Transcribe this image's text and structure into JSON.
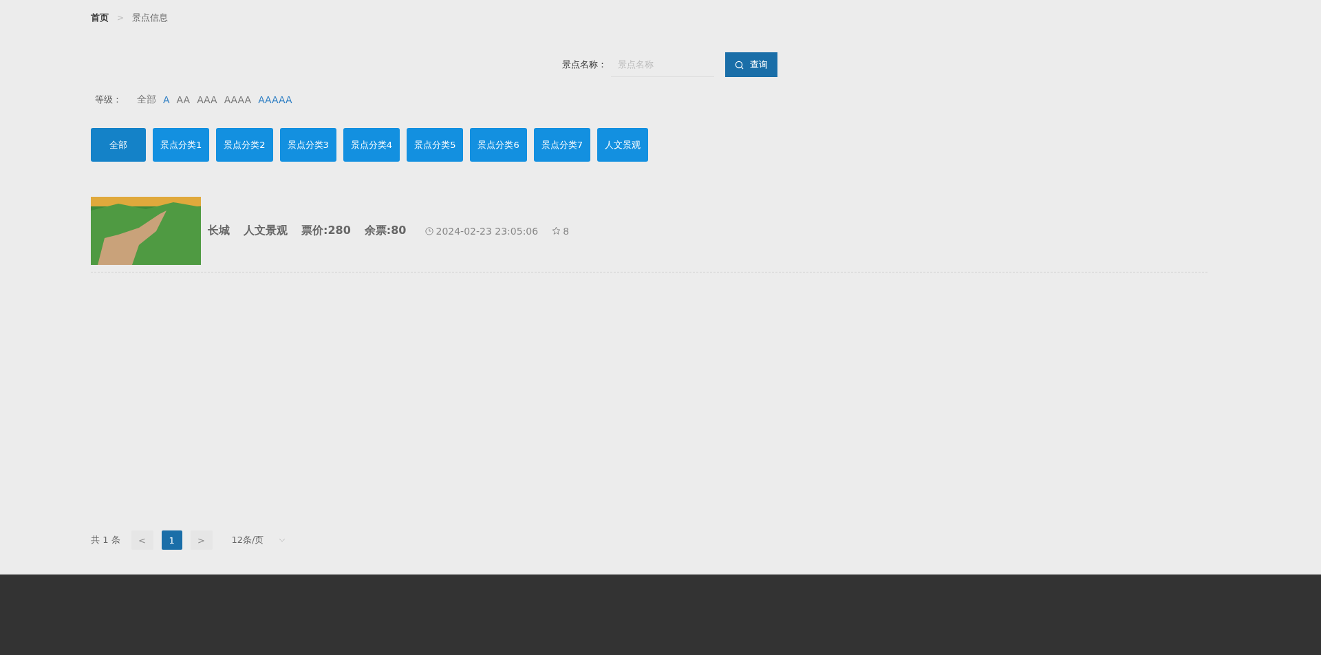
{
  "breadcrumb": [
    {
      "label": "首页",
      "current": false
    },
    {
      "label": "景点信息",
      "current": true
    }
  ],
  "breadcrumb_separator": ">",
  "search": {
    "label": "景点名称：",
    "placeholder": "景点名称",
    "button": "查询"
  },
  "level_filter": {
    "label": "等级：",
    "options": [
      {
        "label": "全部",
        "selected": false
      },
      {
        "label": "A",
        "selected": true
      },
      {
        "label": "AA",
        "selected": false
      },
      {
        "label": "AAA",
        "selected": false
      },
      {
        "label": "AAAA",
        "selected": false
      },
      {
        "label": "AAAAA",
        "selected": true
      }
    ]
  },
  "categories": [
    {
      "label": "全部",
      "selected": true
    },
    {
      "label": "景点分类1",
      "selected": false
    },
    {
      "label": "景点分类2",
      "selected": false
    },
    {
      "label": "景点分类3",
      "selected": false
    },
    {
      "label": "景点分类4",
      "selected": false
    },
    {
      "label": "景点分类5",
      "selected": false
    },
    {
      "label": "景点分类6",
      "selected": false
    },
    {
      "label": "景点分类7",
      "selected": false
    },
    {
      "label": "人文景观",
      "selected": false
    }
  ],
  "items": [
    {
      "name": "长城",
      "category": "人文景观",
      "price": "票价:280",
      "remaining": "余票:80",
      "time": "2024-02-23 23:05:06",
      "favorites": "8"
    }
  ],
  "pagination": {
    "total": "共 1 条",
    "prev": "<",
    "pages": [
      {
        "label": "1",
        "selected": true
      }
    ],
    "next": ">",
    "page_size": "12条/页"
  }
}
